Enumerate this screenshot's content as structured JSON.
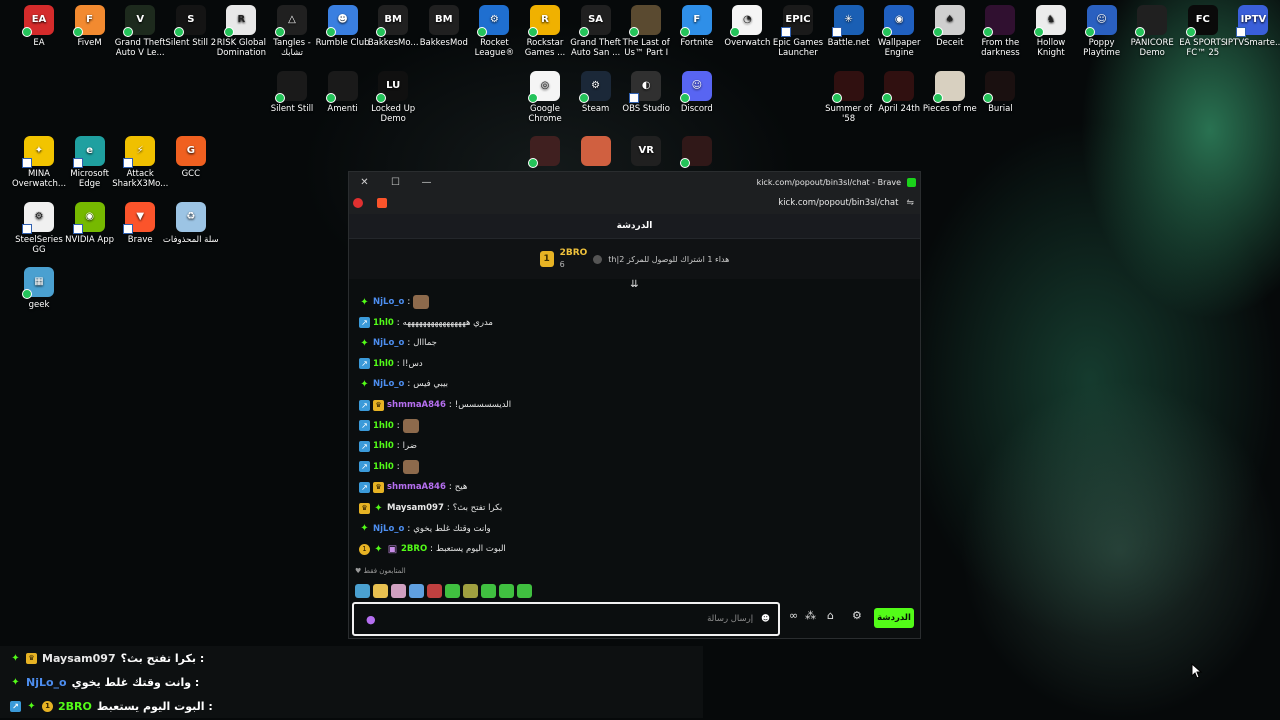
{
  "desktop": {
    "icons": [
      {
        "label": "EA",
        "bg": "#d42b2b",
        "glyph": "EA",
        "badge": "check",
        "col": 0,
        "row": 0
      },
      {
        "label": "FiveM",
        "bg": "#f28a30",
        "glyph": "F",
        "badge": "check",
        "col": 1,
        "row": 0
      },
      {
        "label": "Grand Theft Auto V Le...",
        "bg": "#1d2a1d",
        "glyph": "V",
        "badge": "check",
        "col": 2,
        "row": 0
      },
      {
        "label": "Silent Still 2",
        "bg": "#141414",
        "glyph": "S",
        "badge": "check",
        "col": 3,
        "row": 0
      },
      {
        "label": "RISK Global Domination",
        "bg": "#e8e8e8",
        "glyph": "R",
        "badge": "check",
        "col": 4,
        "row": 0
      },
      {
        "label": "Tangles - تشابك",
        "bg": "#202020",
        "glyph": "△",
        "badge": "check",
        "col": 5,
        "row": 0
      },
      {
        "label": "Rumble Club",
        "bg": "#3a7fe0",
        "glyph": "☻",
        "badge": "check",
        "col": 6,
        "row": 0
      },
      {
        "label": "BakkesMo...",
        "bg": "#202020",
        "glyph": "BM",
        "badge": "check",
        "col": 7,
        "row": 0
      },
      {
        "label": "BakkesMod",
        "bg": "#202020",
        "glyph": "BM",
        "badge": "none",
        "col": 8,
        "row": 0
      },
      {
        "label": "Rocket League®",
        "bg": "#1f6fd0",
        "glyph": "⚙",
        "badge": "check",
        "col": 9,
        "row": 0
      },
      {
        "label": "Rockstar Games ...",
        "bg": "#f0b100",
        "glyph": "R",
        "badge": "check",
        "col": 10,
        "row": 0
      },
      {
        "label": "Grand Theft Auto San ...",
        "bg": "#202020",
        "glyph": "SA",
        "badge": "check",
        "col": 11,
        "row": 0
      },
      {
        "label": "The Last of Us™ Part I",
        "bg": "#5a4a30",
        "glyph": "",
        "badge": "check",
        "col": 12,
        "row": 0
      },
      {
        "label": "Fortnite",
        "bg": "#2f8fe8",
        "glyph": "F",
        "badge": "check",
        "col": 13,
        "row": 0
      },
      {
        "label": "Overwatch",
        "bg": "#f5f5f5",
        "glyph": "◔",
        "badge": "check",
        "col": 14,
        "row": 0
      },
      {
        "label": "Epic Games Launcher",
        "bg": "#1a1a1a",
        "glyph": "EPIC",
        "badge": "shortcut",
        "col": 15,
        "row": 0
      },
      {
        "label": "Battle.net",
        "bg": "#1a5fb4",
        "glyph": "✳",
        "badge": "shortcut",
        "col": 16,
        "row": 0
      },
      {
        "label": "Wallpaper Engine",
        "bg": "#2060c0",
        "glyph": "◉",
        "badge": "check",
        "col": 17,
        "row": 0
      },
      {
        "label": "Deceit",
        "bg": "#cfcfcf",
        "glyph": "♠",
        "badge": "check",
        "col": 18,
        "row": 0
      },
      {
        "label": "From the darkness",
        "bg": "#301030",
        "glyph": "",
        "badge": "check",
        "col": 19,
        "row": 0
      },
      {
        "label": "Hollow Knight",
        "bg": "#ececec",
        "glyph": "♞",
        "badge": "check",
        "col": 20,
        "row": 0
      },
      {
        "label": "Poppy Playtime",
        "bg": "#2a60c0",
        "glyph": "☺",
        "badge": "check",
        "col": 21,
        "row": 0
      },
      {
        "label": "PANICORE Demo",
        "bg": "#202020",
        "glyph": "",
        "badge": "check",
        "col": 22,
        "row": 0
      },
      {
        "label": "EA SPORTS FC™ 25",
        "bg": "#0a0a0a",
        "glyph": "FC",
        "badge": "check",
        "col": 23,
        "row": 0
      },
      {
        "label": "IPTVSmarte...",
        "bg": "#3a5fd9",
        "glyph": "IPTV",
        "badge": "shortcut",
        "col": 24,
        "row": 0
      },
      {
        "label": "Silent Still",
        "bg": "#1a1a1a",
        "glyph": "",
        "badge": "check",
        "col": 5,
        "row": 1
      },
      {
        "label": "Amenti",
        "bg": "#1a1a1a",
        "glyph": "",
        "badge": "check",
        "col": 6,
        "row": 1
      },
      {
        "label": "Locked Up Demo",
        "bg": "#101010",
        "glyph": "LU",
        "badge": "check",
        "col": 7,
        "row": 1
      },
      {
        "label": "Google Chrome",
        "bg": "#f5f5f5",
        "glyph": "◎",
        "badge": "check",
        "col": 10,
        "row": 1
      },
      {
        "label": "Steam",
        "bg": "#1b2838",
        "glyph": "⚙",
        "badge": "check",
        "col": 11,
        "row": 1
      },
      {
        "label": "OBS Studio",
        "bg": "#303030",
        "glyph": "◐",
        "badge": "shortcut",
        "col": 12,
        "row": 1
      },
      {
        "label": "Discord",
        "bg": "#5865f2",
        "glyph": "☺",
        "badge": "check",
        "col": 13,
        "row": 1
      },
      {
        "label": "Summer of '58",
        "bg": "#301010",
        "glyph": "",
        "badge": "check",
        "col": 16,
        "row": 1
      },
      {
        "label": "April 24th",
        "bg": "#301010",
        "glyph": "",
        "badge": "check",
        "col": 17,
        "row": 1
      },
      {
        "label": "Pieces of me",
        "bg": "#d8d0c0",
        "glyph": "",
        "badge": "check",
        "col": 18,
        "row": 1
      },
      {
        "label": "Burial",
        "bg": "#1a1010",
        "glyph": "",
        "badge": "check",
        "col": 19,
        "row": 1
      },
      {
        "label": "",
        "bg": "#402020",
        "glyph": "",
        "badge": "check",
        "col": 10,
        "row": 2
      },
      {
        "label": "",
        "bg": "#d06040",
        "glyph": "",
        "badge": "none",
        "col": 11,
        "row": 2
      },
      {
        "label": "",
        "bg": "#202020",
        "glyph": "VR",
        "badge": "none",
        "col": 12,
        "row": 2
      },
      {
        "label": "",
        "bg": "#301818",
        "glyph": "",
        "badge": "check",
        "col": 13,
        "row": 2
      },
      {
        "label": "MINA Overwatch...",
        "bg": "#f2c400",
        "glyph": "✦",
        "badge": "shortcut",
        "col": 0,
        "row": 2
      },
      {
        "label": "Microsoft Edge",
        "bg": "#1fa0a0",
        "glyph": "e",
        "badge": "shortcut",
        "col": 1,
        "row": 2
      },
      {
        "label": "Attack SharkX3Mo...",
        "bg": "#f0c000",
        "glyph": "⚡",
        "badge": "shortcut",
        "col": 2,
        "row": 2
      },
      {
        "label": "GCC",
        "bg": "#f06020",
        "glyph": "G",
        "badge": "none",
        "col": 3,
        "row": 2
      },
      {
        "label": "SteelSeries GG",
        "bg": "#f0f0f0",
        "glyph": "⚙",
        "badge": "shortcut",
        "col": 0,
        "row": 3
      },
      {
        "label": "NVIDIA App",
        "bg": "#76b900",
        "glyph": "◉",
        "badge": "shortcut",
        "col": 1,
        "row": 3
      },
      {
        "label": "Brave",
        "bg": "#fb542b",
        "glyph": "▼",
        "badge": "shortcut",
        "col": 2,
        "row": 3
      },
      {
        "label": "سلة المحذوفات",
        "bg": "#9cc4e4",
        "glyph": "♻",
        "badge": "none",
        "col": 3,
        "row": 3
      },
      {
        "label": "geek",
        "bg": "#4aa0d0",
        "glyph": "▦",
        "badge": "check",
        "col": 0,
        "row": 4
      }
    ]
  },
  "browser": {
    "title": "kick.com/popout/bin3sl/chat - Brave",
    "url": "kick.com/popout/bin3sl/chat",
    "close": "✕",
    "maximize": "☐",
    "minimize": "—",
    "chat_header": "الدردشة",
    "pinned": {
      "name": "2BRO",
      "count": "6",
      "rank_badge": "1",
      "text": "th|هداء 1 اشتراك للوصول للمركز 2"
    },
    "messages": [
      {
        "badges": [
          "gem"
        ],
        "user": "NjLo_o",
        "color": "#4d8ef0",
        "text": "",
        "emote": true
      },
      {
        "badges": [
          "sub"
        ],
        "user": "1hl0",
        "color": "#53fc18",
        "text": "مدري ههههههههههههههههه",
        "emote": false
      },
      {
        "badges": [
          "gem"
        ],
        "user": "NjLo_o",
        "color": "#4d8ef0",
        "text": "جمااال",
        "emote": false
      },
      {
        "badges": [
          "sub"
        ],
        "user": "1hl0",
        "color": "#53fc18",
        "text": "دس!ا",
        "emote": false
      },
      {
        "badges": [
          "gem"
        ],
        "user": "NjLo_o",
        "color": "#4d8ef0",
        "text": "بيبي فيس",
        "emote": false
      },
      {
        "badges": [
          "sub",
          "crown"
        ],
        "user": "shmmaA846",
        "color": "#b66ff0",
        "text": "!الديسسسسس",
        "emote": false
      },
      {
        "badges": [
          "sub"
        ],
        "user": "1hl0",
        "color": "#53fc18",
        "text": "",
        "emote": true
      },
      {
        "badges": [
          "sub"
        ],
        "user": "1hl0",
        "color": "#53fc18",
        "text": "ضرا",
        "emote": false
      },
      {
        "badges": [
          "sub"
        ],
        "user": "1hl0",
        "color": "#53fc18",
        "text": "",
        "emote": true
      },
      {
        "badges": [
          "sub",
          "crown"
        ],
        "user": "shmmaA846",
        "color": "#b66ff0",
        "text": "هيح",
        "emote": false
      },
      {
        "badges": [
          "crown",
          "gem"
        ],
        "user": "Maysam097",
        "color": "#e8e8e8",
        "text": "بكرا تفتح بث؟",
        "emote": false
      },
      {
        "badges": [
          "gem"
        ],
        "user": "NjLo_o",
        "color": "#4d8ef0",
        "text": "وانت وقتك غلط يخوي",
        "emote": false
      },
      {
        "badges": [
          "one",
          "gem",
          "gift"
        ],
        "user": "2BRO",
        "color": "#53fc18",
        "text": "البوت اليوم يستعبط",
        "emote": false
      }
    ],
    "followers_only": "المتابعون فقط",
    "emotes": [
      "#4aa0d0",
      "#e8c050",
      "#d0a0c0",
      "#60a0e0",
      "#c04040",
      "#40c040",
      "#a0a040",
      "#40c040",
      "#40c040",
      "#40c040"
    ],
    "input_placeholder": "إرسال رسالة",
    "chat_button": "الدردشة"
  },
  "overlay": [
    {
      "badges": [
        "gem",
        "crown"
      ],
      "user": "Maysam097",
      "color": "#e8e8e8",
      "text": "بكرا تفتح بث؟ :"
    },
    {
      "badges": [
        "gem"
      ],
      "user": "NjLo_o",
      "color": "#4d8ef0",
      "text": "وانت وقتك غلط يخوي :"
    },
    {
      "badges": [
        "sub",
        "gem",
        "one"
      ],
      "user": "2BRO",
      "color": "#53fc18",
      "text": "البوت اليوم يستعبط :"
    }
  ]
}
